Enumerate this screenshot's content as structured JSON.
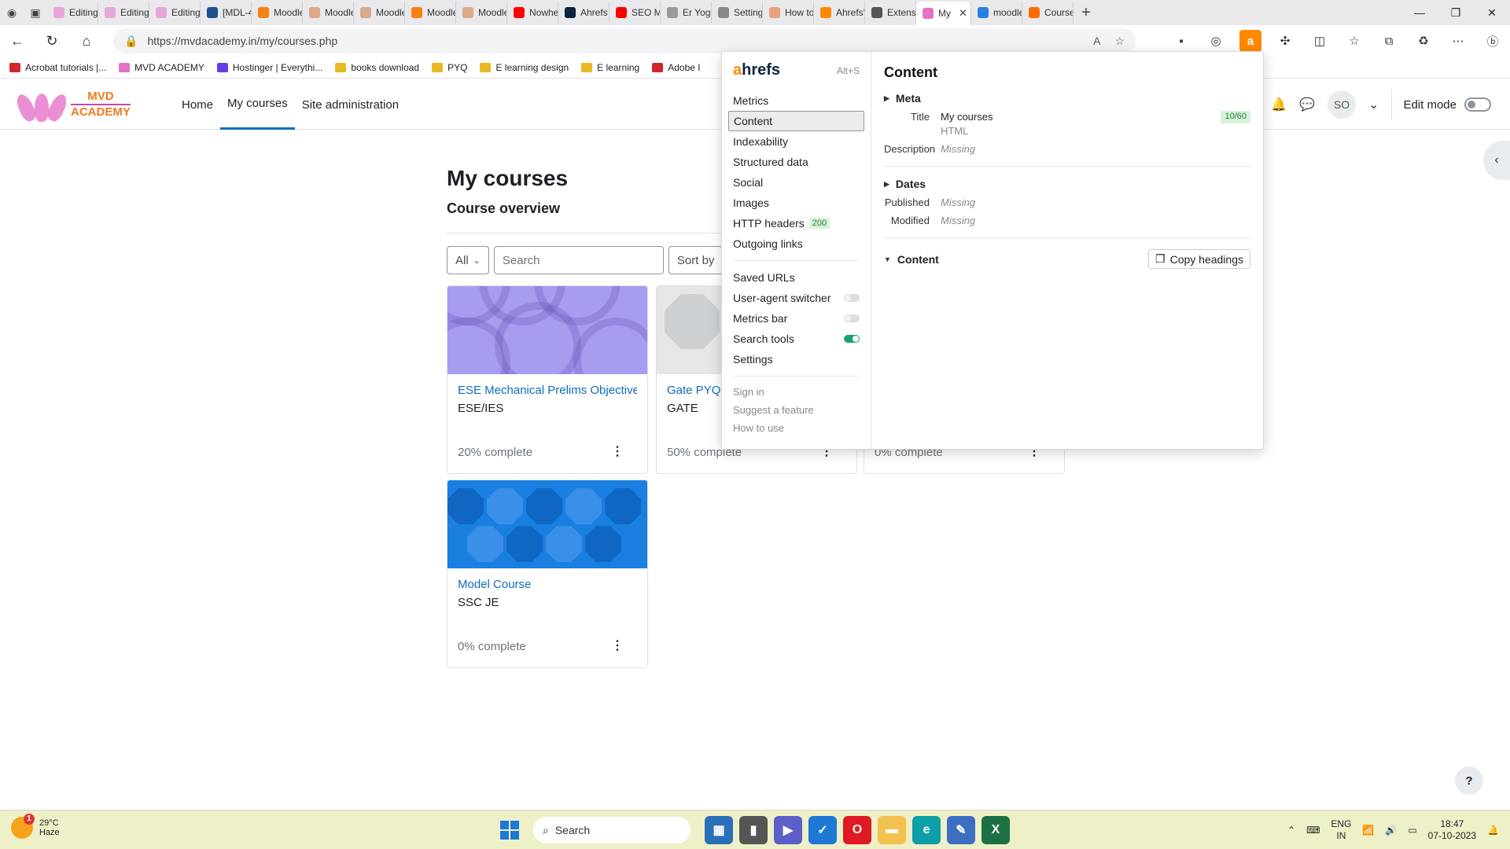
{
  "browser": {
    "tabs": [
      {
        "label": "Editing",
        "color": "#e8a6d8"
      },
      {
        "label": "Editing",
        "color": "#e8a6d8"
      },
      {
        "label": "Editing",
        "color": "#e8a6d8"
      },
      {
        "label": "[MDL-4",
        "color": "#1d4f91"
      },
      {
        "label": "Moodle",
        "color": "#f98012"
      },
      {
        "label": "Moodle",
        "color": "#d9a98a"
      },
      {
        "label": "Moodle",
        "color": "#d9a98a"
      },
      {
        "label": "Moodle",
        "color": "#f98012"
      },
      {
        "label": "Moodle",
        "color": "#d9a98a"
      },
      {
        "label": "Nowher",
        "color": "#ff0000"
      },
      {
        "label": "Ahrefs S",
        "color": "#0a2540"
      },
      {
        "label": "SEO Mir",
        "color": "#ff0000"
      },
      {
        "label": "Er Yoge",
        "color": "#999999"
      },
      {
        "label": "Settings",
        "color": "#888888"
      },
      {
        "label": "How to",
        "color": "#e8a080"
      },
      {
        "label": "Ahrefs'",
        "color": "#ff8800"
      },
      {
        "label": "Extensio",
        "color": "#555555"
      },
      {
        "label": "My",
        "color": "#e573c8",
        "active": true
      },
      {
        "label": "moodle",
        "color": "#2a7de1"
      },
      {
        "label": "Course:",
        "color": "#ff6a00"
      }
    ],
    "url": "https://mvdacademy.in/my/courses.php",
    "bookmarks": [
      {
        "label": "Acrobat tutorials |...",
        "color": "#d1272c"
      },
      {
        "label": "MVD ACADEMY",
        "color": "#e573c8"
      },
      {
        "label": "Hostinger | Everythi...",
        "color": "#673de6"
      },
      {
        "label": "books download",
        "color": "#e8b923"
      },
      {
        "label": "PYQ",
        "color": "#e8b923"
      },
      {
        "label": "E learning design",
        "color": "#e8b923"
      },
      {
        "label": "E learning",
        "color": "#e8b923"
      },
      {
        "label": "Adobe I",
        "color": "#d1272c"
      }
    ]
  },
  "site": {
    "logo_line1": "MVD",
    "logo_line2": "ACADEMY",
    "nav": {
      "home": "Home",
      "my_courses": "My courses",
      "site_admin": "Site administration"
    },
    "avatar_initials": "SO",
    "edit_mode": "Edit mode"
  },
  "main": {
    "title": "My courses",
    "subtitle": "Course overview",
    "filter_all": "All",
    "search_placeholder": "Search",
    "sort_label": "Sort by",
    "courses": [
      {
        "name": "ESE Mechanical Prelims Objective",
        "category": "ESE/IES",
        "progress": "20% complete"
      },
      {
        "name": "Gate PYQ M",
        "category": "GATE",
        "progress": "50% complete"
      },
      {
        "name": "",
        "category": "",
        "progress": "0% complete"
      },
      {
        "name": "Model Course",
        "category": "SSC JE",
        "progress": "0% complete"
      }
    ]
  },
  "ahrefs": {
    "brand_a": "a",
    "brand_rest": "hrefs",
    "shortcut": "Alt+S",
    "menu": {
      "metrics": "Metrics",
      "content": "Content",
      "indexability": "Indexability",
      "structured": "Structured data",
      "social": "Social",
      "images": "Images",
      "http": "HTTP headers",
      "http_code": "200",
      "outgoing": "Outgoing links",
      "saved": "Saved URLs",
      "ua": "User-agent switcher",
      "metrics_bar": "Metrics bar",
      "search_tools": "Search tools",
      "settings": "Settings",
      "sign_in": "Sign in",
      "suggest": "Suggest a feature",
      "how": "How to use"
    },
    "panel": {
      "heading": "Content",
      "meta": "Meta",
      "title_k": "Title",
      "title_v": "My courses",
      "title_sub": "HTML",
      "title_count": "10/60",
      "desc_k": "Description",
      "desc_v": "Missing",
      "dates": "Dates",
      "published_k": "Published",
      "published_v": "Missing",
      "modified_k": "Modified",
      "modified_v": "Missing",
      "content": "Content",
      "copy": "Copy headings"
    }
  },
  "taskbar": {
    "temp": "29°C",
    "weather": "Haze",
    "weather_badge": "1",
    "search": "Search",
    "lang1": "ENG",
    "lang2": "IN",
    "time": "18:47",
    "date": "07-10-2023"
  }
}
